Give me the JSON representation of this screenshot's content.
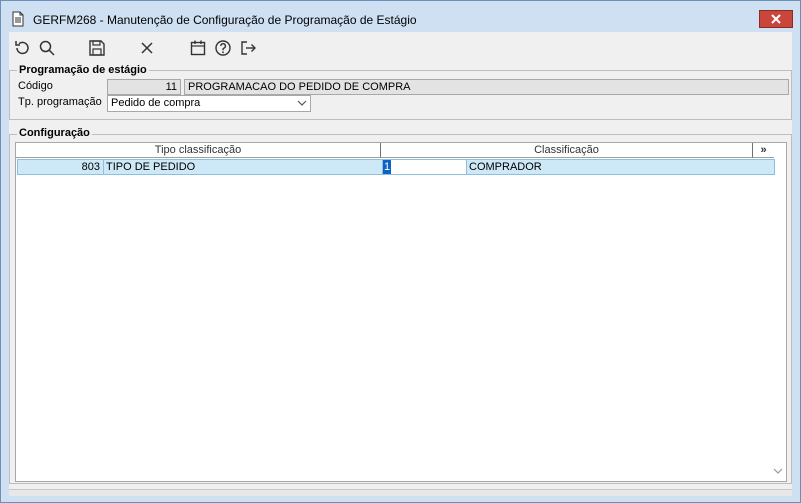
{
  "window": {
    "title": "GERFM268 - Manutenção de Configuração de Programação de Estágio"
  },
  "toolbar": {
    "buttons": [
      {
        "name": "refresh-icon"
      },
      {
        "name": "search-icon"
      },
      {
        "name": "save-icon"
      },
      {
        "name": "cancel-icon"
      },
      {
        "name": "calendar-icon"
      },
      {
        "name": "help-icon"
      },
      {
        "name": "exit-icon"
      }
    ]
  },
  "programacao": {
    "legend": "Programação de estágio",
    "codigo_label": "Código",
    "codigo_value": "11",
    "descricao_value": "PROGRAMACAO DO PEDIDO DE COMPRA",
    "tipo_label": "Tp. programação",
    "tipo_value": "Pedido de compra"
  },
  "configuracao": {
    "legend": "Configuração",
    "columns": {
      "tipo": "Tipo classificação",
      "classificacao": "Classificação",
      "more": "»"
    },
    "rows": [
      {
        "tipo_codigo": "803",
        "tipo_nome": "TIPO DE PEDIDO",
        "class_codigo": "1",
        "class_nome": "COMPRADOR"
      }
    ]
  },
  "colors": {
    "titlebar": "#cfe0f3",
    "close": "#c9463d",
    "row_selected": "#cde8f7",
    "cell_focus": "#0a64c8"
  }
}
